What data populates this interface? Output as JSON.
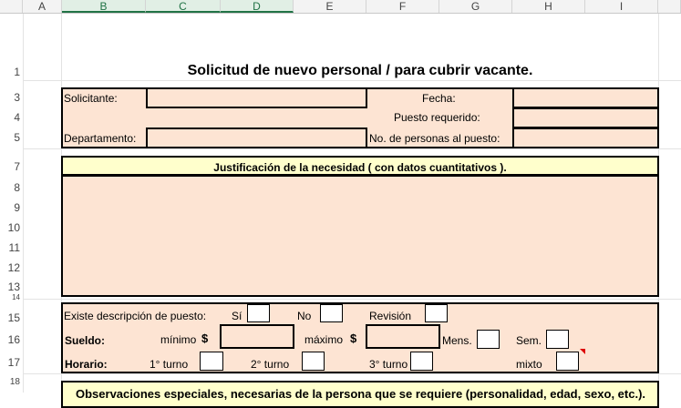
{
  "columns": [
    "A",
    "B",
    "C",
    "D",
    "E",
    "F",
    "G",
    "H",
    "I"
  ],
  "rows": [
    "1",
    "3",
    "4",
    "5",
    "7",
    "8",
    "9",
    "10",
    "11",
    "12",
    "13",
    "14",
    "15",
    "16",
    "17",
    "18"
  ],
  "title": "Solicitud de nuevo personal / para cubrir vacante.",
  "labels": {
    "solicitante": "Solicitante:",
    "fecha": "Fecha:",
    "puesto": "Puesto requerido:",
    "departamento": "Departamento:",
    "personas": "No. de personas al puesto:",
    "justificacion": "Justificación de la necesidad ( con datos cuantitativos ).",
    "existe": "Existe descripción de puesto:",
    "si": "Sí",
    "no": "No",
    "revision": "Revisión",
    "sueldo": "Sueldo:",
    "minimo": "mínimo",
    "maximo": "máximo",
    "dollar": "$",
    "mens": "Mens.",
    "sem": "Sem.",
    "horario": "Horario:",
    "turno1": "1° turno",
    "turno2": "2° turno",
    "turno3": "3° turno",
    "mixto": "mixto",
    "observaciones_partial": "Observaciones especiales, necesarias de la persona que se requiere (personalidad, edad, sexo, etc.)."
  },
  "fields": {
    "solicitante": "",
    "fecha": "",
    "puesto": "",
    "departamento": "",
    "personas": "",
    "justificacion": "",
    "sueldo_min": "",
    "sueldo_max": ""
  },
  "colors": {
    "panel_fill": "#fde4d3",
    "header_fill": "#ffffcc",
    "selected_col": "#217346"
  }
}
